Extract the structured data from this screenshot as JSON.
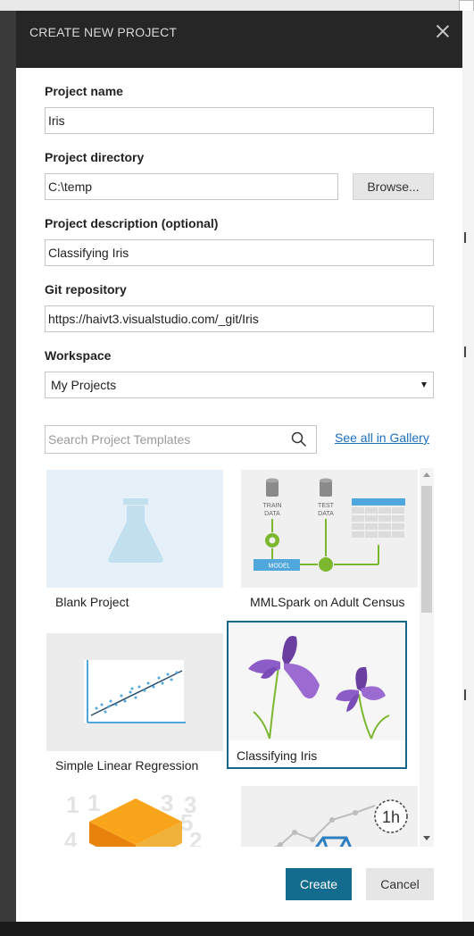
{
  "dialog": {
    "title": "CREATE NEW PROJECT",
    "close_icon": "close-icon"
  },
  "form": {
    "project_name": {
      "label": "Project name",
      "value": "Iris"
    },
    "project_directory": {
      "label": "Project directory",
      "value": "C:\\temp",
      "browse_label": "Browse..."
    },
    "project_description": {
      "label": "Project description (optional)",
      "value": "Classifying Iris"
    },
    "git_repository": {
      "label": "Git repository",
      "value": "https://haivt3.visualstudio.com/_git/Iris"
    },
    "workspace": {
      "label": "Workspace",
      "selected": "My Projects"
    }
  },
  "templates": {
    "search_placeholder": "Search Project Templates",
    "search_icon": "search-icon",
    "gallery_link": "See all in Gallery",
    "items": [
      {
        "label": "Blank Project",
        "selected": false
      },
      {
        "label": "MMLSpark on Adult Census",
        "selected": false
      },
      {
        "label": "Simple Linear Regression",
        "selected": false
      },
      {
        "label": "Classifying Iris",
        "selected": true
      },
      {
        "label": "",
        "selected": false
      },
      {
        "label": "",
        "selected": false
      }
    ],
    "thumb_text": {
      "train": "TRAIN",
      "test": "TEST",
      "data": "DATA",
      "model": "MODEL",
      "duration": "1h"
    }
  },
  "actions": {
    "create_label": "Create",
    "cancel_label": "Cancel"
  },
  "colors": {
    "header_bg": "#262626",
    "primary_button": "#136b8e",
    "link": "#1a6fbd",
    "selected_outline": "#14668a"
  }
}
